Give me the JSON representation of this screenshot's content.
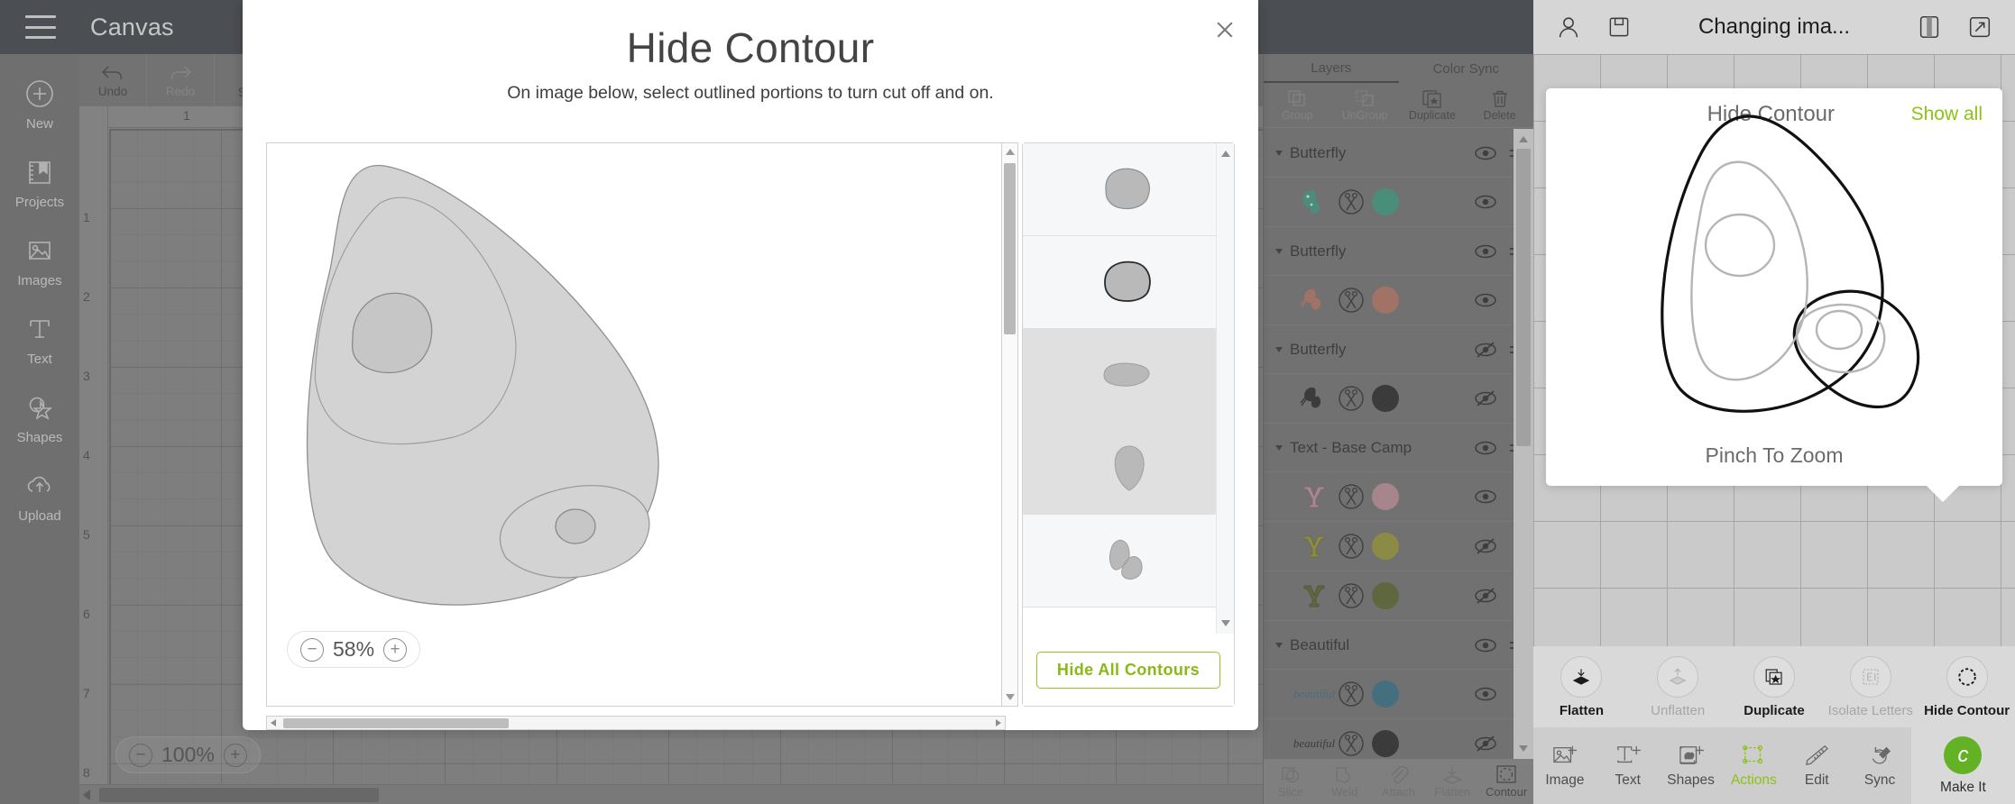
{
  "app": {
    "title": "Canvas",
    "hamburger_icon": "hamburger-menu-icon"
  },
  "left_nav": [
    {
      "label": "New",
      "icon": "plus-circle-icon"
    },
    {
      "label": "Projects",
      "icon": "projects-bookmark-icon"
    },
    {
      "label": "Images",
      "icon": "image-icon"
    },
    {
      "label": "Text",
      "icon": "text-t-icon"
    },
    {
      "label": "Shapes",
      "icon": "shapes-star-icon"
    },
    {
      "label": "Upload",
      "icon": "cloud-upload-icon"
    }
  ],
  "canvas_toolbar": [
    {
      "label": "Undo",
      "icon": "undo-arrow-icon",
      "enabled": true
    },
    {
      "label": "Redo",
      "icon": "redo-arrow-icon",
      "enabled": false
    },
    {
      "label": "Select All",
      "icon": "select-all-dashed-box-icon",
      "enabled": true
    }
  ],
  "canvas": {
    "zoom": "100%",
    "zoom_out_icon": "minus-icon",
    "zoom_in_icon": "plus-icon",
    "ruler_numbers": [
      "1",
      "2",
      "3",
      "4",
      "5",
      "6",
      "7",
      "8"
    ],
    "ruler_top_number": "1"
  },
  "layers_panel": {
    "tabs": [
      {
        "label": "Layers",
        "active": true
      },
      {
        "label": "Color Sync",
        "active": false
      }
    ],
    "operations": [
      {
        "label": "Group",
        "icon": "group-icon",
        "enabled": false
      },
      {
        "label": "UnGroup",
        "icon": "ungroup-icon",
        "enabled": false
      },
      {
        "label": "Duplicate",
        "icon": "duplicate-icon",
        "enabled": true
      },
      {
        "label": "Delete",
        "icon": "trash-icon",
        "enabled": true
      }
    ],
    "rows": [
      {
        "kind": "group",
        "name": "Butterfly",
        "visible": true
      },
      {
        "kind": "layer",
        "thumb": "butterfly-glyph",
        "color": "#2a9d7f",
        "visible": true,
        "cut_icon": "scissors-cut-icon"
      },
      {
        "kind": "group",
        "name": "Butterfly",
        "visible": true
      },
      {
        "kind": "layer",
        "thumb": "butterfly-glyph",
        "color": "#c0705c",
        "visible": true,
        "cut_icon": "scissors-cut-icon"
      },
      {
        "kind": "group",
        "name": "Butterfly",
        "visible": false
      },
      {
        "kind": "layer",
        "thumb": "butterfly-glyph",
        "color": "#111111",
        "visible": false,
        "cut_icon": "scissors-cut-icon"
      },
      {
        "kind": "group",
        "name": "Text - Base Camp",
        "visible": true
      },
      {
        "kind": "layer",
        "thumb": "letter-Y-glyph",
        "color": "#c8909c",
        "visible": true,
        "cut_icon": "scissors-cut-icon"
      },
      {
        "kind": "layer",
        "thumb": "letter-Y-glyph",
        "color": "#9a9a24",
        "visible": false,
        "cut_icon": "scissors-cut-icon"
      },
      {
        "kind": "layer",
        "thumb": "letter-Y-glyph",
        "color": "#4f5c18",
        "visible": false,
        "cut_icon": "scissors-cut-icon"
      },
      {
        "kind": "group",
        "name": "Beautiful",
        "visible": true
      },
      {
        "kind": "layer",
        "thumb": "script-beautiful-glyph",
        "color": "#1f6986",
        "visible": true,
        "cut_icon": "scissors-cut-icon"
      },
      {
        "kind": "layer",
        "thumb": "script-beautiful-glyph",
        "color": "#111111",
        "visible": false,
        "cut_icon": "scissors-cut-icon"
      }
    ],
    "bottom_operations": [
      {
        "label": "Slice",
        "icon": "slice-icon",
        "enabled": false
      },
      {
        "label": "Weld",
        "icon": "weld-icon",
        "enabled": false
      },
      {
        "label": "Attach",
        "icon": "attach-paperclip-icon",
        "enabled": false
      },
      {
        "label": "Flatten",
        "icon": "flatten-icon",
        "enabled": false
      },
      {
        "label": "Contour",
        "icon": "contour-dashed-circle-icon",
        "enabled": true
      }
    ]
  },
  "modal": {
    "title": "Hide Contour",
    "subtitle": "On image below, select outlined portions to turn cut off and on.",
    "close_icon": "close-x-icon",
    "zoom": "58%",
    "zoom_out_icon": "minus-icon",
    "zoom_in_icon": "plus-icon",
    "hide_all_label": "Hide All Contours",
    "hide_all_color": "#8aba12",
    "contour_items": [
      {
        "shape": "round-blob",
        "hidden": false
      },
      {
        "shape": "outlined-oval",
        "hidden": false
      },
      {
        "shape": "flat-oval",
        "hidden": true
      },
      {
        "shape": "teardrop",
        "hidden": true
      },
      {
        "shape": "wing-blob",
        "hidden": false
      }
    ]
  },
  "mobile": {
    "header": {
      "title": "Changing ima...",
      "account_icon": "account-person-icon",
      "save_icon": "save-floppy-icon",
      "panel_icon": "panel-toggle-icon",
      "expand_icon": "expand-arrows-icon"
    },
    "popover": {
      "title": "Hide Contour",
      "show_all_label": "Show all",
      "show_all_color": "#8cc314",
      "pinch_label": "Pinch To Zoom"
    },
    "actions": [
      {
        "label": "Flatten",
        "icon": "flatten-down-icon",
        "enabled": true
      },
      {
        "label": "Unflatten",
        "icon": "unflatten-up-icon",
        "enabled": false
      },
      {
        "label": "Duplicate",
        "icon": "duplicate-star-icon",
        "enabled": true
      },
      {
        "label": "Isolate Letters",
        "icon": "isolate-letters-icon",
        "enabled": false
      },
      {
        "label": "Hide Contour",
        "icon": "contour-dashed-circle-icon",
        "enabled": true
      }
    ],
    "tabs": [
      {
        "label": "Image",
        "icon": "image-plus-icon",
        "active": false
      },
      {
        "label": "Text",
        "icon": "text-plus-icon",
        "active": false
      },
      {
        "label": "Shapes",
        "icon": "shapes-plus-icon",
        "active": false
      },
      {
        "label": "Actions",
        "icon": "actions-nodes-icon",
        "active": true
      },
      {
        "label": "Edit",
        "icon": "ruler-edit-icon",
        "active": false
      },
      {
        "label": "Sync",
        "icon": "sync-icon",
        "active": false
      }
    ],
    "make_it": {
      "label": "Make It",
      "icon": "cricut-c-icon",
      "color": "#63b226"
    }
  }
}
